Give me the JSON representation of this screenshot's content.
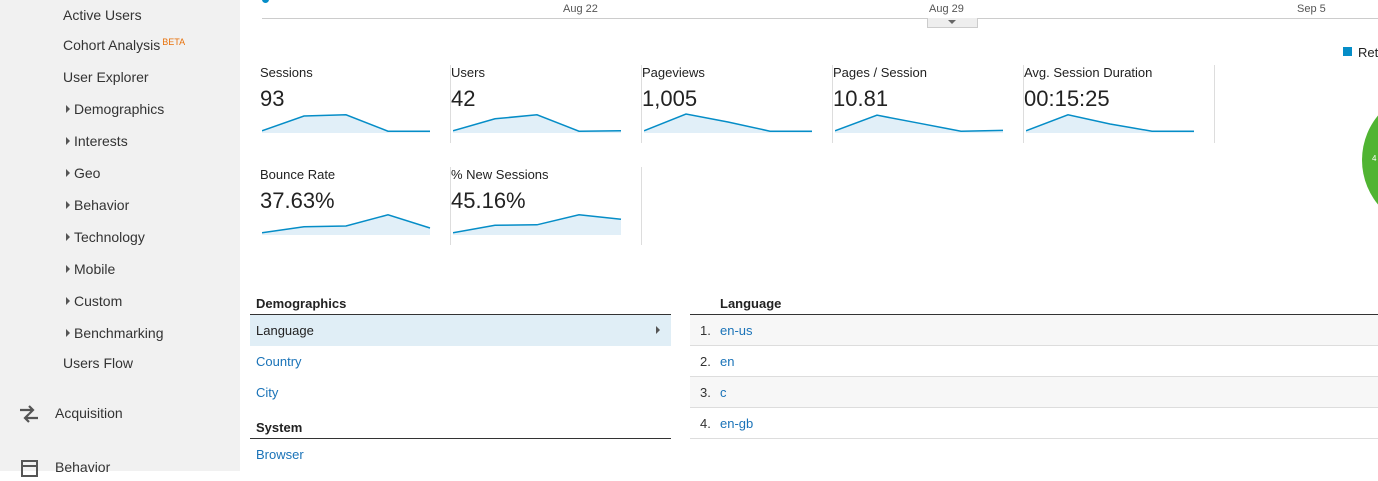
{
  "sidebar": {
    "items": [
      {
        "label": "Active Users"
      },
      {
        "label": "Cohort Analysis",
        "badge": "BETA"
      },
      {
        "label": "User Explorer"
      }
    ],
    "groups": [
      {
        "label": "Demographics"
      },
      {
        "label": "Interests"
      },
      {
        "label": "Geo"
      },
      {
        "label": "Behavior"
      },
      {
        "label": "Technology"
      },
      {
        "label": "Mobile"
      },
      {
        "label": "Custom"
      },
      {
        "label": "Benchmarking"
      }
    ],
    "users_flow": "Users Flow",
    "sections": [
      {
        "label": "Acquisition",
        "icon": "acquisition-icon"
      },
      {
        "label": "Behavior",
        "icon": "behavior-icon"
      }
    ]
  },
  "timeline": {
    "ticks": [
      "Aug 22",
      "Aug 29",
      "Sep 5"
    ]
  },
  "metrics": [
    {
      "label": "Sessions",
      "value": "93",
      "spark": [
        3,
        40,
        43,
        2,
        2
      ]
    },
    {
      "label": "Users",
      "value": "42",
      "spark": [
        3,
        33,
        43,
        2,
        3
      ]
    },
    {
      "label": "Pageviews",
      "value": "1,005",
      "spark": [
        3,
        45,
        25,
        2,
        2
      ]
    },
    {
      "label": "Pages / Session",
      "value": "10.81",
      "spark": [
        3,
        42,
        22,
        2,
        4
      ]
    },
    {
      "label": "Avg. Session Duration",
      "value": "00:15:25",
      "spark": [
        3,
        43,
        20,
        2,
        2
      ]
    },
    {
      "label": "Bounce Rate",
      "value": "37.63%",
      "spark": [
        3,
        18,
        20,
        48,
        15
      ]
    },
    {
      "label": "% New Sessions",
      "value": "45.16%",
      "spark": [
        3,
        22,
        23,
        48,
        37
      ]
    }
  ],
  "legend": {
    "label": "Ret",
    "color": "#058dc7"
  },
  "pie": {
    "label": "4",
    "color": "#50b432"
  },
  "demographics": {
    "title": "Demographics",
    "rows": [
      "Language",
      "Country",
      "City"
    ],
    "selected": "Language",
    "system_title": "System",
    "system_rows": [
      "Browser"
    ]
  },
  "language_table": {
    "title": "Language",
    "rows": [
      {
        "num": "1.",
        "value": "en-us"
      },
      {
        "num": "2.",
        "value": "en"
      },
      {
        "num": "3.",
        "value": "c"
      },
      {
        "num": "4.",
        "value": "en-gb"
      }
    ]
  },
  "colors": {
    "accent": "#058dc7",
    "sidebar_bg": "#f1f1f1",
    "link": "#1a73b8"
  }
}
